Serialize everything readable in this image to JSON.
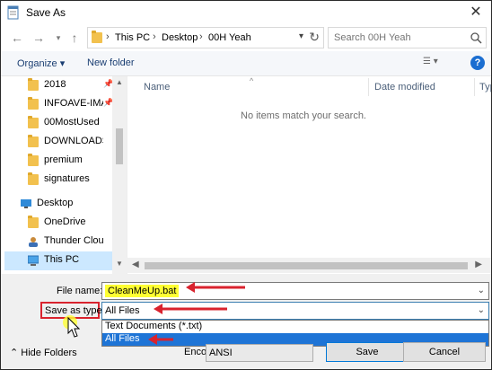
{
  "window": {
    "title": "Save As",
    "close_label": "✕"
  },
  "address": {
    "crumbs": [
      "This PC",
      "Desktop",
      "00H Yeah"
    ],
    "search_placeholder": "Search 00H Yeah"
  },
  "toolbar": {
    "organize_label": "Organize ▾",
    "new_folder_label": "New folder",
    "help_label": "?"
  },
  "nav": {
    "items": [
      {
        "label": "2018",
        "icon": "folder-icon",
        "pinned": true
      },
      {
        "label": "INFOAVE-IMA",
        "icon": "folder-icon",
        "pinned": true
      },
      {
        "label": "00MostUsed",
        "icon": "folder-icon",
        "pinned": false
      },
      {
        "label": "DOWNLOADS",
        "icon": "folder-icon",
        "pinned": false
      },
      {
        "label": "premium",
        "icon": "folder-icon",
        "pinned": false
      },
      {
        "label": "signatures",
        "icon": "folder-icon",
        "pinned": false
      },
      {
        "label": "Desktop",
        "icon": "desktop-icon",
        "pinned": false
      },
      {
        "label": "OneDrive",
        "icon": "folder-icon",
        "pinned": false
      },
      {
        "label": "Thunder Cloud",
        "icon": "user-icon",
        "pinned": false
      },
      {
        "label": "This PC",
        "icon": "computer-icon",
        "pinned": false
      }
    ]
  },
  "content": {
    "columns": [
      "Name",
      "Date modified",
      "Typ"
    ],
    "empty_message": "No items match your search."
  },
  "form": {
    "filename_label": "File name:",
    "filename_value": "CleanMeUp.bat",
    "savetype_label": "Save as type:",
    "savetype_value": "All Files",
    "savetype_options": [
      "Text Documents (*.txt)",
      "All Files"
    ],
    "hide_folders_label": "Hide Folders",
    "encoding_label": "Encoding:",
    "encoding_value": "ANSI",
    "save_label": "Save",
    "cancel_label": "Cancel"
  },
  "colors": {
    "accent": "#1e74d6",
    "highlight_yellow": "#ffff33",
    "annotation_red": "#d9232e"
  }
}
